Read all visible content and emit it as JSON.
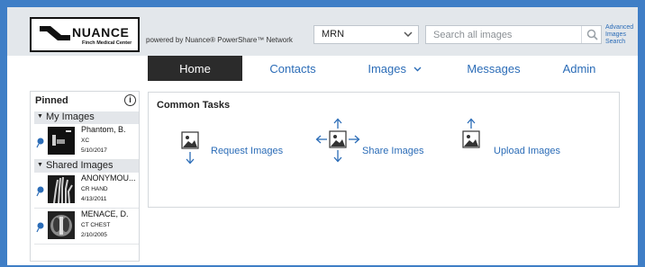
{
  "header": {
    "logo": {
      "brand": "NUANCE",
      "tagline": "Finch Medical Center"
    },
    "powered_by": "powered by Nuance® PowerShare™ Network",
    "search_type": {
      "selected": "MRN"
    },
    "search": {
      "placeholder": "Search all images",
      "value": ""
    },
    "advanced_search_label": "Advanced Images Search"
  },
  "nav": {
    "items": [
      {
        "label": "Home",
        "active": true
      },
      {
        "label": "Contacts"
      },
      {
        "label": "Images",
        "has_dropdown": true
      },
      {
        "label": "Messages"
      },
      {
        "label": "Admin"
      }
    ]
  },
  "pinned": {
    "title": "Pinned",
    "groups": [
      {
        "label": "My Images",
        "items": [
          {
            "name": "Phantom, B.",
            "modality": "XC",
            "date": "5/10/2017"
          }
        ]
      },
      {
        "label": "Shared Images",
        "items": [
          {
            "name": "ANONYMOU...",
            "modality": "CR HAND",
            "date": "4/13/2011"
          },
          {
            "name": "MENACE, D.",
            "modality": "CT CHEST",
            "date": "2/10/2005"
          }
        ]
      }
    ]
  },
  "tasks": {
    "title": "Common Tasks",
    "items": [
      {
        "label": "Request Images"
      },
      {
        "label": "Share Images"
      },
      {
        "label": "Upload Images"
      }
    ]
  },
  "colors": {
    "frame": "#3f7ec6",
    "header_bg": "#e3e7eb",
    "link": "#2b6cb7",
    "nav_active": "#2b2b2b"
  }
}
